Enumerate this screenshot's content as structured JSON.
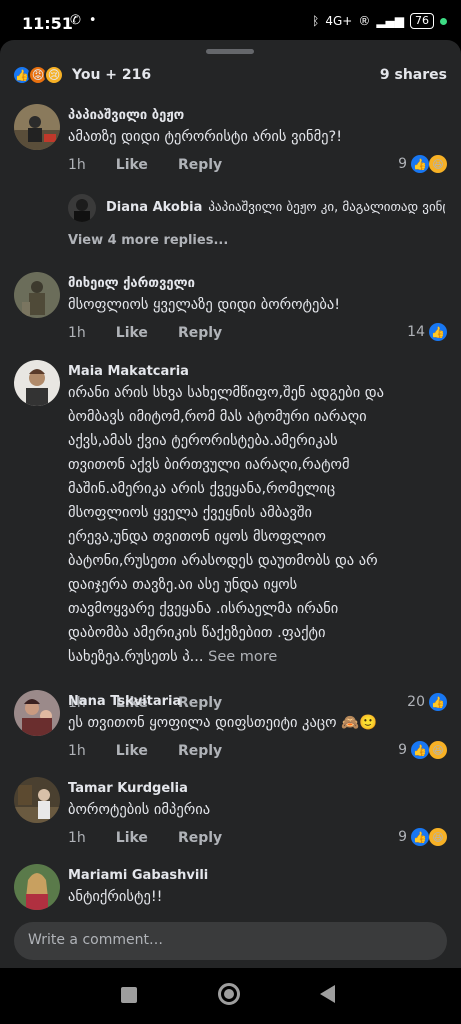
{
  "status_bar": {
    "time": "11:51",
    "network": "4G+",
    "battery": "76"
  },
  "reactions": {
    "summary": "You + 216",
    "shares": "9 shares"
  },
  "comments": [
    {
      "name": "პაპიაშვილი ბეჟო",
      "text": "ამათზე დიდი ტერორისტი არის ვინმე?!",
      "time": "1h",
      "like": "Like",
      "reply": "Reply",
      "count": "9",
      "reply_preview": {
        "name": "Diana Akobia",
        "text": "პაპიაშვილი ბეჟო კი, მაგალითად ვინც..."
      },
      "view_more": "View 4 more replies..."
    },
    {
      "name": "მიხეილ ქართველი",
      "text": "მსოფლიოს ყველაზე დიდი ბოროტება!",
      "time": "1h",
      "like": "Like",
      "reply": "Reply",
      "count": "14"
    },
    {
      "name": "Maia Makatcaria",
      "lines": [
        "ირანი არის სხვა სახელმწიფო,შენ ადგები და",
        "ბომბავს იმიტომ,რომ მას ატომური იარაღი",
        "აქვს,ამას ქვია ტერორისტება.ამერიკას",
        "თვითონ აქვს ბირთვული იარაღი,რატომ",
        "მაშინ.ამერიკა არის ქვეყანა,რომელიც",
        "მსოფლიოს ყველა ქვეყნის ამბავში",
        "ერევა,უნდა თვითონ იყოს მსოფლიო",
        "ბატონი,რუსეთი არასოდეს დაუთმობს და არ",
        "დაიჯერა თავზე.აი ასე უნდა იყოს",
        "თავმოყვარე ქვეყანა .ისრაელმა ირანი",
        "დაბომბა ამერიკის წაქეზებით .ფაქტი"
      ],
      "last_line": "სახეზეა.რუსეთს პ...",
      "see_more": "See more",
      "time": "1h",
      "like": "Like",
      "reply": "Reply",
      "count": "20"
    },
    {
      "name": "Nana Tskvitaria",
      "text": "ეს თვითონ ყოფილა დიფსთეიტი კაცო 🙈🙂",
      "time": "1h",
      "like": "Like",
      "reply": "Reply",
      "count": "9"
    },
    {
      "name": "Tamar Kurdgelia",
      "text": "ბოროტების იმპერია",
      "time": "1h",
      "like": "Like",
      "reply": "Reply",
      "count": "9"
    },
    {
      "name": "Mariami Gabashvili",
      "text": "ანტიქრისტე!!"
    }
  ],
  "composer": {
    "placeholder": "Write a comment…"
  },
  "icons": {
    "like": "thumbs-up-icon",
    "angry": "angry-face-icon",
    "sad": "sad-face-icon",
    "haha": "laughing-face-icon"
  },
  "colors": {
    "sheet_bg": "#242526",
    "text_primary": "#e4e6eb",
    "text_secondary": "#b0b3b8",
    "like_blue": "#1877f2"
  }
}
